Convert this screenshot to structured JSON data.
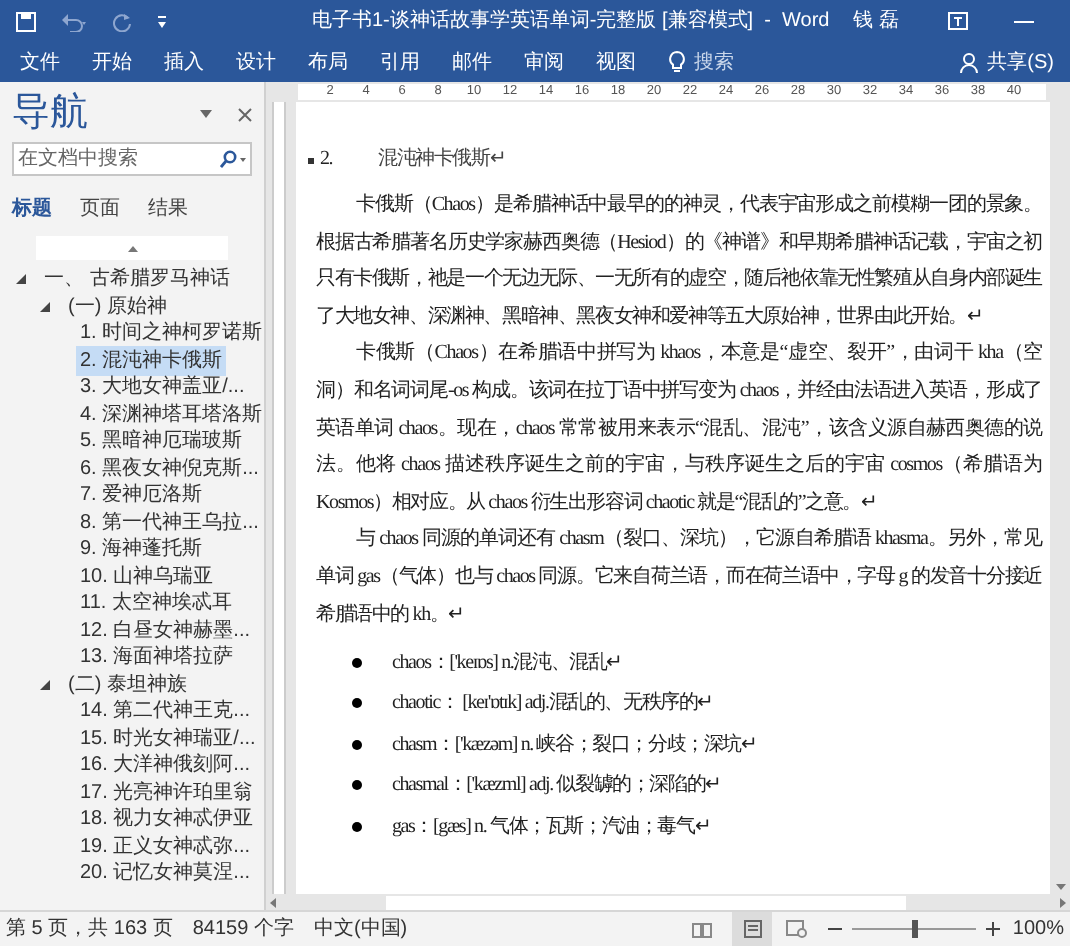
{
  "window": {
    "title": "电子书1-谈神话故事学英语单词-完整版 [兼容模式]  -  Word",
    "user": "钱 磊"
  },
  "ribbon_tabs": [
    "文件",
    "开始",
    "插入",
    "设计",
    "布局",
    "引用",
    "邮件",
    "审阅",
    "视图"
  ],
  "tell_me": {
    "placeholder": "搜索"
  },
  "share": "共享(S)",
  "ruler": {
    "ticks": [
      "2",
      "4",
      "6",
      "8",
      "10",
      "12",
      "14",
      "16",
      "18",
      "20",
      "22",
      "24",
      "26",
      "28",
      "30",
      "32",
      "34",
      "36",
      "38",
      "40"
    ]
  },
  "navigation": {
    "title": "导航",
    "search": {
      "placeholder": "在文档中搜索"
    },
    "tabs": [
      {
        "label": "标题",
        "selected": true
      },
      {
        "label": "页面",
        "selected": false
      },
      {
        "label": "结果",
        "selected": false
      }
    ],
    "tree": [
      {
        "label": "一、 古希腊罗马神话",
        "expanded": true,
        "selected": false,
        "children": [
          {
            "label": "(一) 原始神",
            "expanded": true,
            "selected": false,
            "children": [
              {
                "label": "1. 时间之神柯罗诺斯",
                "selected": false
              },
              {
                "label": "2. 混沌神卡俄斯",
                "selected": true
              },
              {
                "label": "3. 大地女神盖亚/...",
                "selected": false
              },
              {
                "label": "4. 深渊神塔耳塔洛斯",
                "selected": false
              },
              {
                "label": "5. 黑暗神厄瑞玻斯",
                "selected": false
              },
              {
                "label": "6. 黑夜女神倪克斯...",
                "selected": false
              },
              {
                "label": "7. 爱神厄洛斯",
                "selected": false
              },
              {
                "label": "8. 第一代神王乌拉...",
                "selected": false
              },
              {
                "label": "9. 海神蓬托斯",
                "selected": false
              },
              {
                "label": "10. 山神乌瑞亚",
                "selected": false
              },
              {
                "label": "11. 太空神埃忒耳",
                "selected": false
              },
              {
                "label": "12. 白昼女神赫墨...",
                "selected": false
              },
              {
                "label": "13. 海面神塔拉萨",
                "selected": false
              }
            ]
          },
          {
            "label": "(二) 泰坦神族",
            "expanded": true,
            "selected": false,
            "children": [
              {
                "label": "14. 第二代神王克...",
                "selected": false
              },
              {
                "label": "15. 时光女神瑞亚/...",
                "selected": false
              },
              {
                "label": "16. 大洋神俄刻阿...",
                "selected": false
              },
              {
                "label": "17. 光亮神许珀里翁",
                "selected": false
              },
              {
                "label": "18. 视力女神忒伊亚",
                "selected": false
              },
              {
                "label": "19. 正义女神忒弥...",
                "selected": false
              },
              {
                "label": "20. 记忆女神莫涅...",
                "selected": false
              }
            ]
          }
        ]
      }
    ]
  },
  "document": {
    "heading": {
      "number": "2.",
      "text": "混沌神卡俄斯↵"
    },
    "paragraphs": [
      "卡俄斯（Chaos）是希腊神话中最早的的神灵，代表宇宙形成之前模糊一团的景象。根据古希腊著名历史学家赫西奥德（Hesiod）的《神谱》和早期希腊神话记载，宇宙之初只有卡俄斯，祂是一个无边无际、一无所有的虚空，随后祂依靠无性繁殖从自身内部诞生了大地女神、深渊神、黑暗神、黑夜女神和爱神等五大原始神，世界由此开始。↵",
      "卡俄斯（Chaos）在希腊语中拼写为 khaos，本意是“虚空、裂开”，由词干 kha（空洞）和名词词尾-os 构成。该词在拉丁语中拼写变为 chaos，并经由法语进入英语，形成了英语单词 chaos。现在，chaos 常常被用来表示“混乱、混沌”，该含义源自赫西奥德的说法。他将 chaos 描述秩序诞生之前的宇宙，与秩序诞生之后的宇宙 cosmos（希腊语为 Kosmos）相对应。从 chaos 衍生出形容词 chaotic 就是“混乱的”之意。↵",
      "与 chaos 同源的单词还有 chasm（裂口、深坑），它源自希腊语 khasma。另外，常见单词 gas（气体）也与 chaos 同源。它来自荷兰语，而在荷兰语中，字母 g 的发音十分接近希腊语中的 kh。↵"
    ],
    "bullets": [
      "chaos：['keɪɒs] n.混沌、混乱↵",
      "chaotic： [keɪ'ɒtɪk] adj.混乱的、无秩序的↵",
      "chasm：['kæzəm] n. 峡谷；裂口；分歧；深坑↵",
      "chasmal：['kæzml] adj. 似裂罅的；深陷的↵",
      "gas：[gæs] n. 气体；瓦斯；汽油；毒气↵"
    ]
  },
  "status_bar": {
    "page": "第 5 页，共 163 页",
    "words": "84159 个字",
    "language": "中文(中国)",
    "zoom": "100%",
    "zoom_level": {
      "level": 0.5
    }
  }
}
